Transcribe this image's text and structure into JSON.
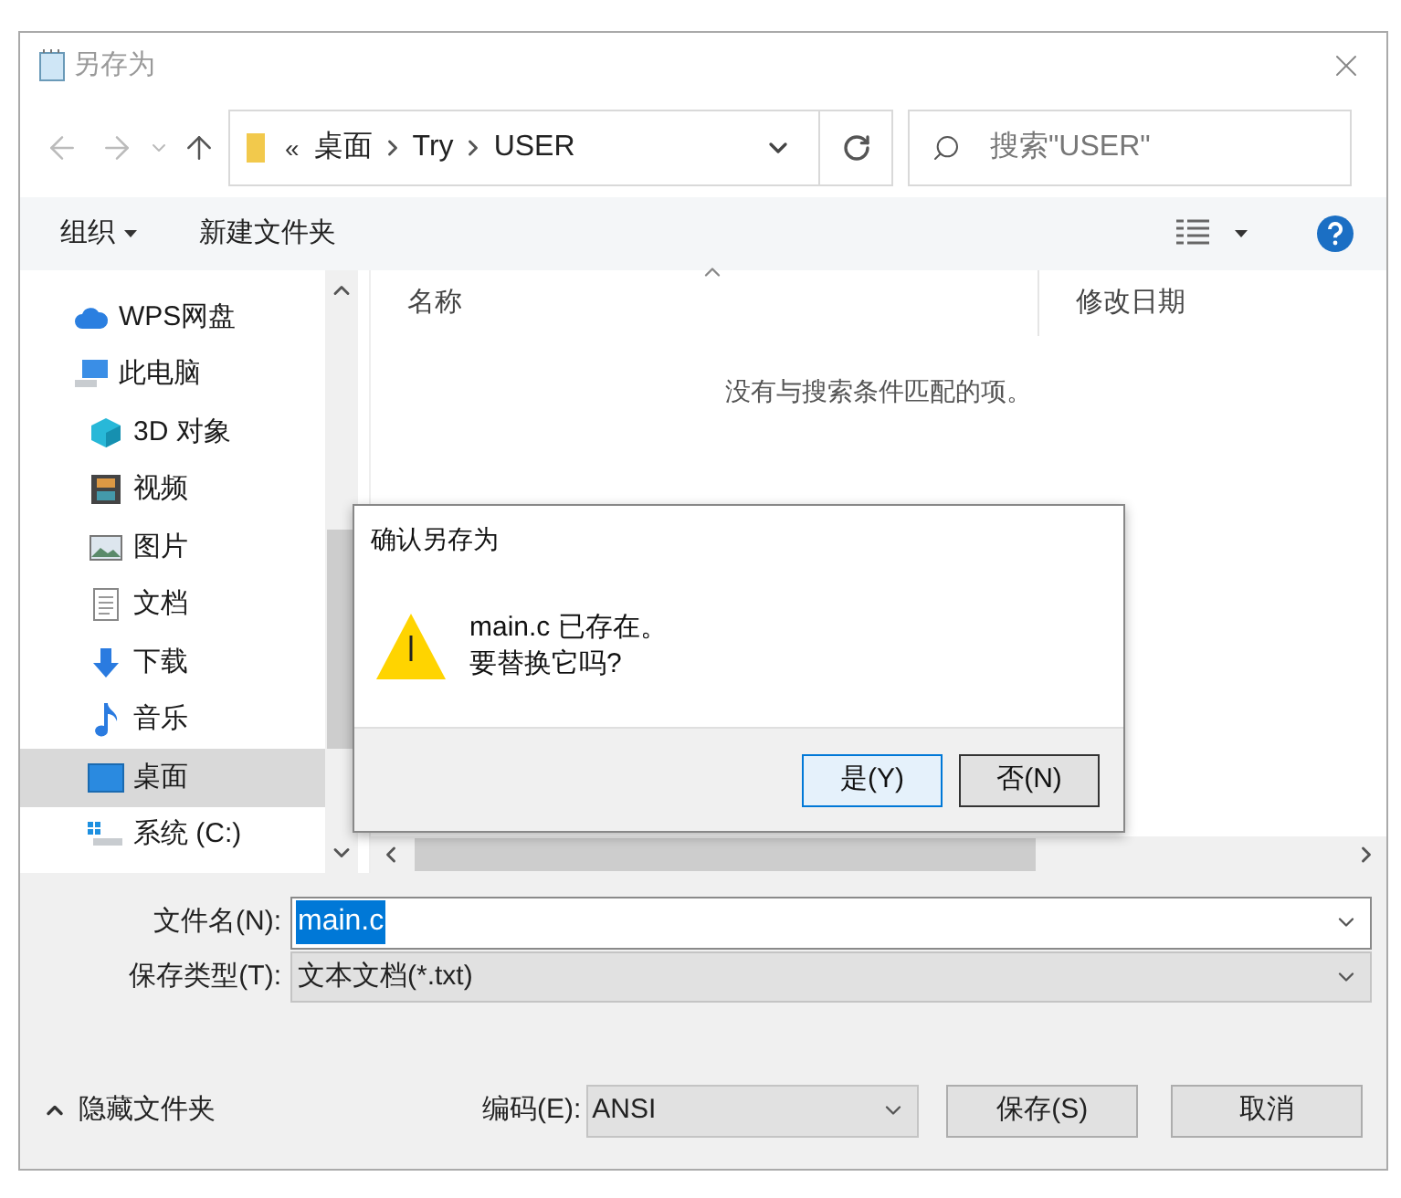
{
  "window": {
    "title": "另存为"
  },
  "address": {
    "overflow_mark": "«",
    "path": [
      "桌面",
      "Try",
      "USER"
    ]
  },
  "search": {
    "placeholder": "搜索\"USER\""
  },
  "toolbar": {
    "organize": "组织",
    "new_folder": "新建文件夹"
  },
  "sidebar": {
    "items": [
      {
        "label": "WPS网盘",
        "kind": "cloud",
        "selected": false
      },
      {
        "label": "此电脑",
        "kind": "pc",
        "selected": false,
        "children": [
          {
            "label": "3D 对象",
            "kind": "cube",
            "selected": false
          },
          {
            "label": "视频",
            "kind": "video",
            "selected": false
          },
          {
            "label": "图片",
            "kind": "picture",
            "selected": false
          },
          {
            "label": "文档",
            "kind": "document",
            "selected": false
          },
          {
            "label": "下载",
            "kind": "download",
            "selected": false
          },
          {
            "label": "音乐",
            "kind": "music",
            "selected": false
          },
          {
            "label": "桌面",
            "kind": "desktop",
            "selected": true
          },
          {
            "label": "系统 (C:)",
            "kind": "drive",
            "selected": false
          }
        ]
      }
    ]
  },
  "file_list": {
    "columns": [
      {
        "label": "名称",
        "sorted": true
      },
      {
        "label": "修改日期",
        "sorted": false
      }
    ],
    "empty_message": "没有与搜索条件匹配的项。"
  },
  "confirm_dialog": {
    "title": "确认另存为",
    "message_lines": [
      "main.c 已存在。",
      "要替换它吗?"
    ],
    "buttons": [
      {
        "label": "是(Y)",
        "default": true
      },
      {
        "label": "否(N)",
        "default": false
      }
    ]
  },
  "form": {
    "file_name": {
      "label": "文件名(N):",
      "value": "main.c",
      "text_selected": true
    },
    "file_type": {
      "label": "保存类型(T):",
      "value": "文本文档(*.txt)"
    },
    "encoding": {
      "label": "编码(E):",
      "value": "ANSI"
    }
  },
  "hide_folders": "隐藏文件夹",
  "buttons": [
    "保存(S)",
    "取消"
  ]
}
